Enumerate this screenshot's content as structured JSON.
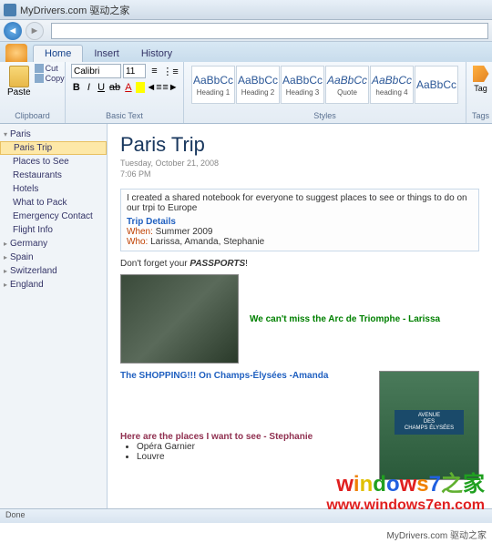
{
  "titlebar": {
    "text": "MyDrivers.com 驱动之家"
  },
  "tabs": {
    "home": "Home",
    "insert": "Insert",
    "history": "History"
  },
  "ribbon": {
    "clipboard": {
      "paste": "Paste",
      "cut": "Cut",
      "copy": "Copy",
      "label": "Clipboard"
    },
    "font": {
      "name": "Calibri",
      "size": "11",
      "label": "Basic Text"
    },
    "styles": {
      "items": [
        {
          "preview": "AaBbCc",
          "name": "Heading 1"
        },
        {
          "preview": "AaBbCc",
          "name": "Heading 2"
        },
        {
          "preview": "AaBbCc",
          "name": "Heading 3"
        },
        {
          "preview": "AaBbCc",
          "name": "Quote"
        },
        {
          "preview": "AaBbCc",
          "name": "heading 4"
        },
        {
          "preview": "AaBbCc",
          "name": ""
        }
      ],
      "label": "Styles"
    },
    "tag": {
      "label": "Tag",
      "group": "Tags"
    }
  },
  "sidebar": {
    "paris": "Paris",
    "children": [
      "Paris Trip",
      "Places to See",
      "Restaurants",
      "Hotels",
      "What to Pack",
      "Emergency Contact",
      "Flight Info"
    ],
    "others": [
      "Germany",
      "Spain",
      "Switzerland",
      "England"
    ]
  },
  "page": {
    "title": "Paris Trip",
    "date": "Tuesday, October 21, 2008",
    "time": "7:06 PM",
    "intro": "I created a shared notebook for everyone to suggest places to see or things to do on our trpi to Europe",
    "details_h": "Trip Details",
    "when_k": "When:",
    "when_v": " Summer 2009",
    "who_k": "Who:",
    "who_v": "  Larissa, Amanda, Stephanie",
    "passports": "Don't forget your PASSPORTS!",
    "cap1": "We can't miss the Arc de Triomphe - Larissa",
    "cap2": "The SHOPPING!!! On Champs-Élysées -Amanda",
    "sign_l1": "AVENUE",
    "sign_l2": "DES",
    "sign_l3": "CHAMPS ÉLYSÉES",
    "cap3": "Here are the places I want to see - Stephanie",
    "bullets": [
      "Opéra Garnier",
      "Louvre"
    ]
  },
  "status": "Done",
  "watermark": {
    "line1": "windows7之家",
    "line2": "www.windows7en.com"
  },
  "credit": "MyDrivers.com 驱动之家"
}
